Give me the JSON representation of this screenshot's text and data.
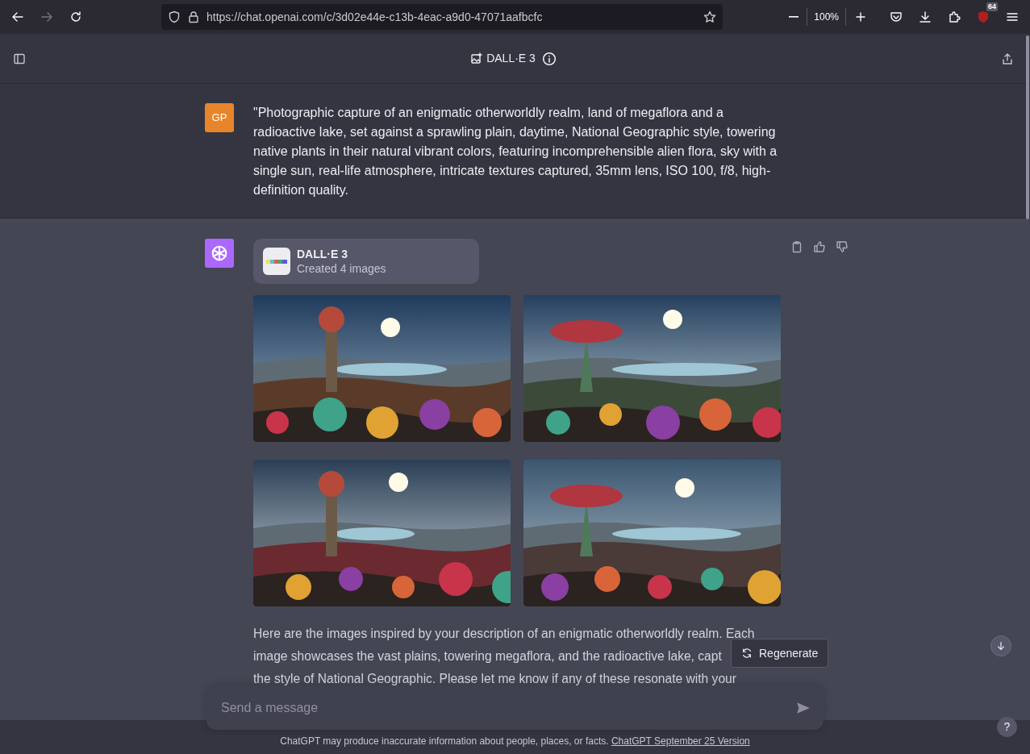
{
  "browser": {
    "back_disabled": false,
    "forward_disabled": true,
    "url": "https://chat.openai.com/c/3d02e44e-c13b-4eac-a9d0-47071aafbcfc",
    "zoom": "100%",
    "extension_badge": "64"
  },
  "header": {
    "title": "DALL·E 3"
  },
  "messages": [
    {
      "kind": "user",
      "avatar": "GP",
      "text": "\"Photographic capture of an enigmatic otherworldly realm, land of megaflora and a radioactive lake, set against a sprawling plain, daytime, National Geographic style, towering native plants in their natural vibrant colors, featuring incomprehensible alien flora, sky with a single sun, real-life atmosphere, intricate textures captured, 35mm lens, ISO 100, f/8, high-definition quality."
    },
    {
      "kind": "assistant",
      "tool": {
        "name": "DALL·E 3",
        "status": "Created 4 images"
      },
      "images": [
        {
          "kind": "picture"
        },
        {
          "kind": "picture"
        },
        {
          "kind": "picture"
        },
        {
          "kind": "picture"
        }
      ],
      "lines": [
        "Here are the images inspired by your description of an enigmatic otherworldly realm. Each",
        "image showcases the vast plains, towering megaflora, and the radioactive lake, capt",
        "the style of National Geographic. Please let me know if any of these resonate with your"
      ]
    }
  ],
  "regenerate": "Regenerate",
  "composer": {
    "placeholder": "Send a message"
  },
  "footer": {
    "text": "ChatGPT may produce inaccurate information about people, places, or facts.",
    "link": "ChatGPT September 25 Version"
  },
  "help": "?"
}
